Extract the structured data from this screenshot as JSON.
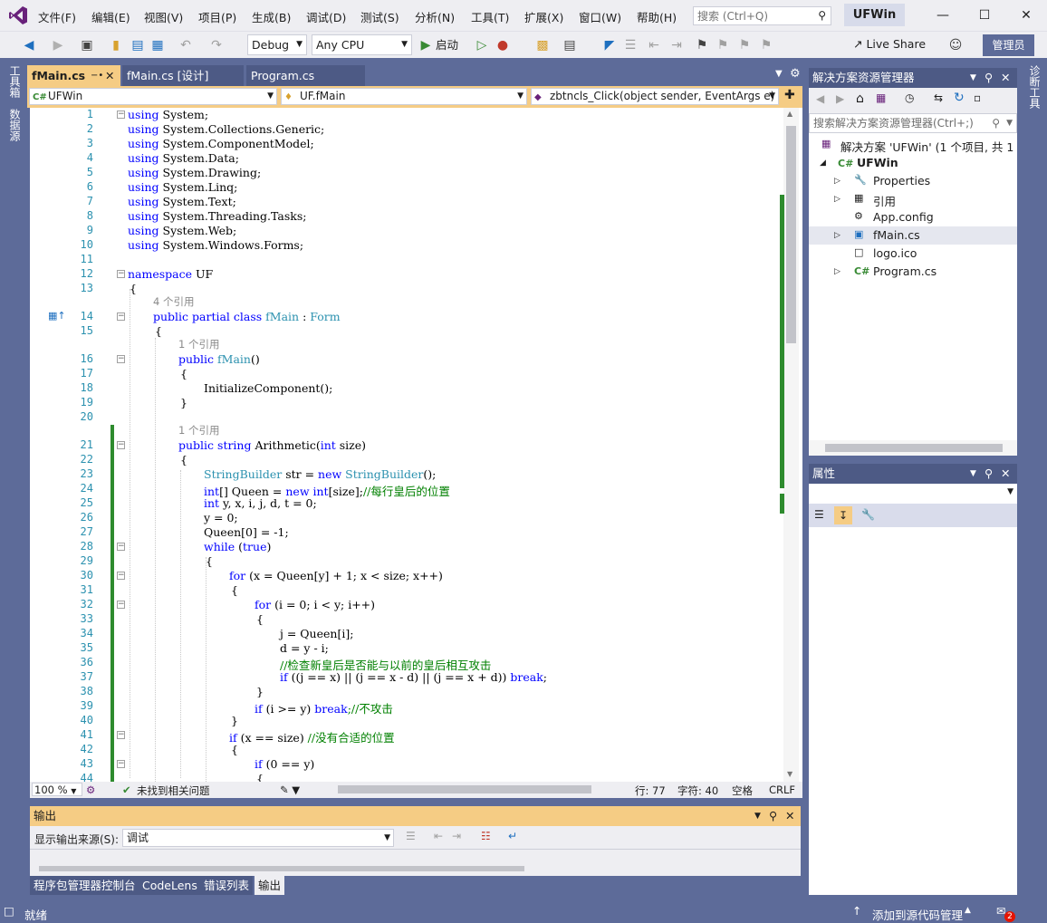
{
  "menubar": {
    "items": [
      "文件(F)",
      "编辑(E)",
      "视图(V)",
      "项目(P)",
      "生成(B)",
      "调试(D)",
      "测试(S)",
      "分析(N)",
      "工具(T)",
      "扩展(X)",
      "窗口(W)",
      "帮助(H)"
    ],
    "search_placeholder": "搜索 (Ctrl+Q)",
    "app_title": "UFWin"
  },
  "toolbar": {
    "config": "Debug",
    "platform": "Any CPU",
    "start_label": "启动",
    "live_share": "Live Share",
    "admin": "管理员"
  },
  "left_strip": {
    "toolbox": "工具箱",
    "datasource": "数据源"
  },
  "right_strip": {
    "diagnostics": "诊断工具"
  },
  "doc_tabs": {
    "tab1": "fMain.cs",
    "tab2": "fMain.cs [设计]",
    "tab3": "Program.cs"
  },
  "navbar": {
    "project": "UFWin",
    "class": "UF.fMain",
    "member": "zbtncls_Click(object sender, EventArgs e)"
  },
  "code": {
    "line_numbers": [
      "1",
      "2",
      "3",
      "4",
      "5",
      "6",
      "7",
      "8",
      "9",
      "10",
      "11",
      "12",
      "13",
      "14",
      "15",
      "16",
      "17",
      "18",
      "19",
      "20",
      "21",
      "22",
      "23",
      "24",
      "25",
      "26",
      "27",
      "28",
      "29",
      "30",
      "31",
      "32",
      "33",
      "34",
      "35",
      "36",
      "37",
      "38",
      "39",
      "40",
      "41",
      "42",
      "43",
      "44"
    ],
    "lens_4refs": "4 个引用",
    "lens_1ref": "1 个引用",
    "using_kw": "using",
    "ns_kw": "namespace",
    "usings": [
      "System;",
      "System.Collections.Generic;",
      "System.ComponentModel;",
      "System.Data;",
      "System.Drawing;",
      "System.Linq;",
      "System.Text;",
      "System.Threading.Tasks;",
      "System.Web;",
      "System.Windows.Forms;"
    ],
    "ns_name": " UF",
    "open_brace": "{",
    "close_brace": "}",
    "class_kw": "public partial class",
    "class_name": " fMain",
    "colon": " : ",
    "base_class": "Form",
    "ctor_kw": "public",
    "ctor_name": " fMain",
    "ctor_args": "()",
    "init_call": "InitializeComponent();",
    "method_kw1": "public string",
    "method_name": " Arithmetic(",
    "method_int": "int",
    "method_rest": " size)",
    "l23_type": "StringBuilder",
    "l23_mid": " str = ",
    "l23_new": "new",
    "l23_end": "();",
    "l24_kw": "int",
    "l24_mid": "[] Queen = ",
    "l24_new": "new int",
    "l24_end": "[size];",
    "l24_cm": "//每行皇后的位置",
    "l25_kw": "int",
    "l25_rest": " y, x, i, j, d, t = 0;",
    "l26": "y = 0;",
    "l27": "Queen[0] = -1;",
    "l28_kw": "while",
    "l28_mid": " (",
    "l28_true": "true",
    "l28_end": ")",
    "l30_kw": "for",
    "l30_rest": " (x = Queen[y] + 1; x < size; x++)",
    "l32_kw": "for",
    "l32_rest": " (i = 0; i < y; i++)",
    "l34": "j = Queen[i];",
    "l35": "d = y - i;",
    "l36_cm": "//检查新皇后是否能与以前的皇后相互攻击",
    "l37_kw": "if",
    "l37_rest": " ((j == x) || (j == x - d) || (j == x + d)) ",
    "l37_break": "break",
    "l37_semi": ";",
    "l39_kw": "if",
    "l39_rest": " (i >= y) ",
    "l39_break": "break",
    "l39_cm": ";//不攻击",
    "l41_kw": "if",
    "l41_rest": " (x == size) ",
    "l41_cm": "//没有合适的位置",
    "l43_kw": "if",
    "l43_rest": " (0 == y)"
  },
  "edit_status": {
    "zoom": "100 %",
    "issues": "未找到相关问题",
    "row": "行: 77",
    "col": "字符: 40",
    "spaces": "空格",
    "eol": "CRLF"
  },
  "output": {
    "title": "输出",
    "source_label": "显示输出来源(S):",
    "source_value": "调试"
  },
  "bottom_tabs": [
    "程序包管理器控制台",
    "CodeLens",
    "错误列表",
    "输出"
  ],
  "solution_explorer": {
    "title": "解决方案资源管理器",
    "search_placeholder": "搜索解决方案资源管理器(Ctrl+;)",
    "solution": "解决方案 'UFWin' (1 个项目, 共 1 个)",
    "project": "UFWin",
    "items": [
      "Properties",
      "引用",
      "App.config",
      "fMain.cs",
      "logo.ico",
      "Program.cs"
    ]
  },
  "properties": {
    "title": "属性"
  },
  "statusbar": {
    "ready": "就绪",
    "source_control": "添加到源代码管理",
    "notifications": "2"
  },
  "colors": {
    "chrome": "#5d6b99",
    "active_tab": "#f5cc84",
    "keyword": "#0000ff",
    "type": "#2b91af",
    "comment": "#008000"
  }
}
